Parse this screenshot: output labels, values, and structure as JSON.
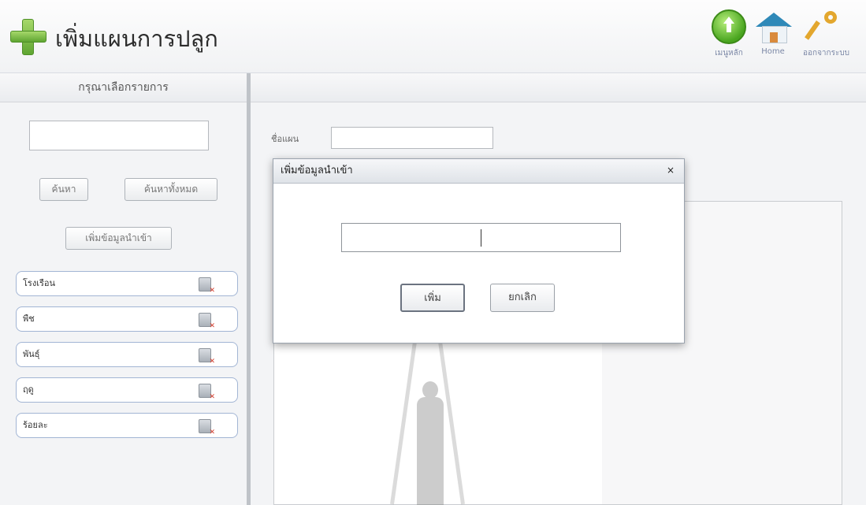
{
  "header": {
    "title": "เพิ่มแผนการปลูก",
    "nav": {
      "main_menu_label": "เมนูหลัก",
      "home_label": "Home",
      "logout_label": "ออกจากระบบ"
    }
  },
  "sidebar": {
    "heading": "กรุณาเลือกรายการ",
    "search_value": "",
    "search_button": "ค้นหา",
    "search_all_button": "ค้นหาทั้งหมด",
    "add_import_button": "เพิ่มข้อมูลนำเข้า",
    "items": [
      {
        "label": "โรงเรือน"
      },
      {
        "label": "พืช"
      },
      {
        "label": "พันธุ์"
      },
      {
        "label": "ฤดู"
      },
      {
        "label": "ร้อยละ"
      }
    ]
  },
  "main": {
    "plan_name_label": "ชื่อแผน",
    "plan_name_value": ""
  },
  "modal": {
    "title": "เพิ่มข้อมูลนำเข้า",
    "close_symbol": "×",
    "input_value": "",
    "add_button": "เพิ่ม",
    "cancel_button": "ยกเลิก"
  },
  "colors": {
    "accent_green": "#5fa532",
    "list_border": "#a2b5d4",
    "nav_text": "#7b87a6"
  },
  "icons": [
    "plus-icon",
    "up-arrow-circle-icon",
    "home-icon",
    "key-icon",
    "delete-icon"
  ]
}
